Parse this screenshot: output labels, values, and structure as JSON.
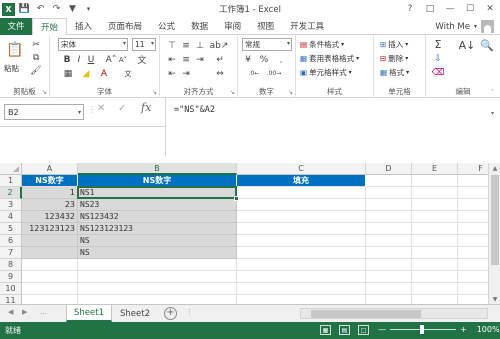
{
  "window": {
    "title": "工作簿1 - Excel",
    "qat": [
      "save-icon",
      "undo-icon",
      "redo-icon",
      "filter-icon",
      "customize-icon"
    ],
    "controls": [
      "?",
      "restore",
      "—",
      "□",
      "✕"
    ]
  },
  "tabs": [
    "文件",
    "开始",
    "插入",
    "页面布局",
    "公式",
    "数据",
    "审阅",
    "视图",
    "开发工具"
  ],
  "active_tab": "开始",
  "user": "With Me",
  "ribbon": {
    "clipboard": {
      "label": "剪贴板",
      "paste": "粘贴"
    },
    "font": {
      "label": "字体",
      "name": "宋体",
      "size": "11",
      "bold": "B",
      "italic": "I",
      "underline": "U"
    },
    "alignment": {
      "label": "对齐方式"
    },
    "number": {
      "label": "数字",
      "format": "常规"
    },
    "styles": {
      "label": "样式",
      "items": [
        "条件格式",
        "套用表格格式",
        "单元格样式"
      ]
    },
    "cells": {
      "label": "单元格",
      "items": [
        "插入",
        "删除",
        "格式"
      ]
    },
    "editing": {
      "label": "编辑"
    }
  },
  "formula_bar": {
    "name_box": "B2",
    "formula": "=\"NS\"&A2"
  },
  "sheet": {
    "columns": [
      "A",
      "B",
      "C",
      "D",
      "E",
      "F"
    ],
    "rows": [
      "1",
      "2",
      "3",
      "4",
      "5",
      "6",
      "7",
      "8",
      "9",
      "10",
      "11"
    ],
    "header_row": {
      "A": "NS数字",
      "B": "NS数字",
      "C": "填充"
    },
    "data": [
      {
        "A": "1",
        "B": "NS1"
      },
      {
        "A": "23",
        "B": "NS23"
      },
      {
        "A": "123432",
        "B": "NS123432"
      },
      {
        "A": "123123123",
        "B": "NS123123123"
      },
      {
        "A": "",
        "B": "NS"
      },
      {
        "A": "",
        "B": "NS"
      }
    ],
    "selected_cell": "B2",
    "colors": {
      "header_fill": "#0070c0",
      "data_fill": "#d9d9d9",
      "accent": "#217346"
    }
  },
  "sheet_tabs": [
    "Sheet1",
    "Sheet2"
  ],
  "active_sheet": "Sheet1",
  "status": {
    "mode": "就绪",
    "zoom": "100%"
  }
}
